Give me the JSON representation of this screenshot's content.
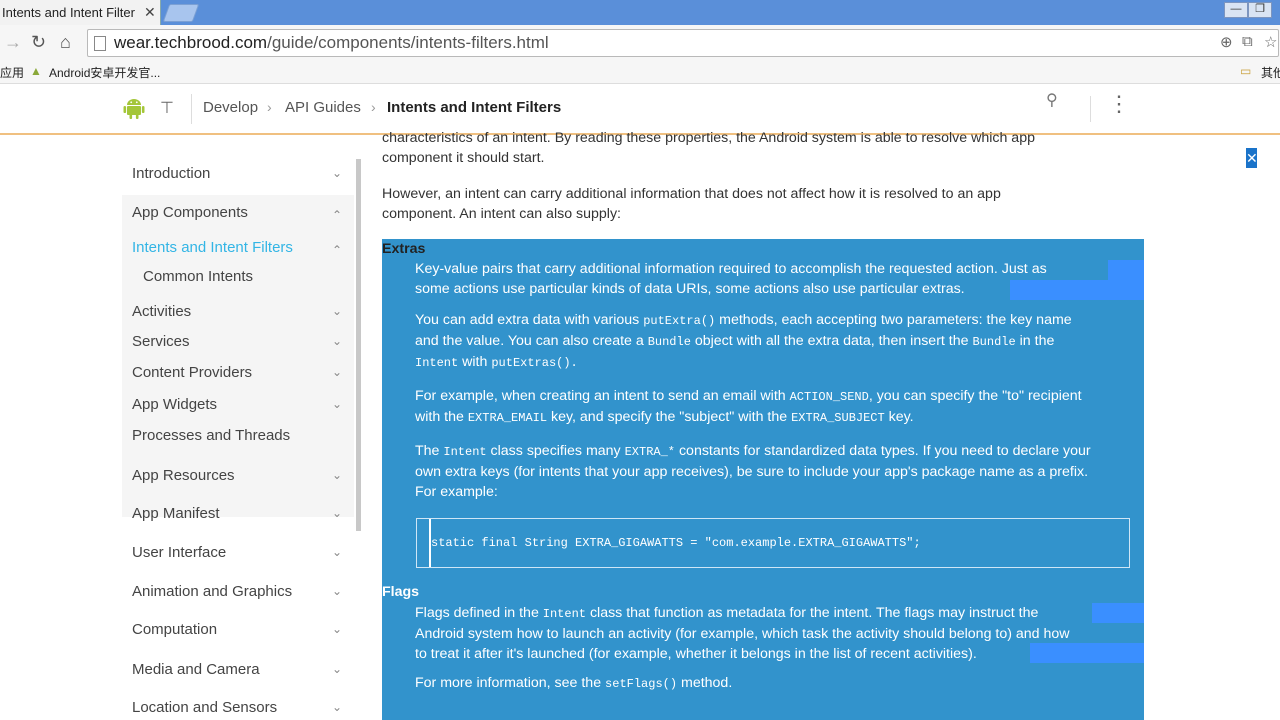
{
  "browser": {
    "tab_title": "Intents and Intent Filter",
    "tab_close": "✕",
    "window_buttons": {
      "minimize": "—",
      "restore": "❐",
      "close": "✕"
    },
    "url_host": "wear.techbrood.com",
    "url_path": "/guide/components/intents-filters.html",
    "bookmarks": {
      "apps": "应用",
      "android": "Android安卓开发官...",
      "other": "其他"
    }
  },
  "header": {
    "crumbs": [
      "Develop",
      "API Guides",
      "Intents and Intent Filters"
    ],
    "chevron": "›"
  },
  "sidebar": {
    "items": [
      {
        "label": "Introduction",
        "arrow": "⌄"
      },
      {
        "label": "App Components",
        "arrow": "⌃"
      },
      {
        "label": "Intents and Intent Filters",
        "arrow": "⌃"
      },
      {
        "label": "Common Intents",
        "arrow": ""
      },
      {
        "label": "Activities",
        "arrow": "⌄"
      },
      {
        "label": "Services",
        "arrow": "⌄"
      },
      {
        "label": "Content Providers",
        "arrow": "⌄"
      },
      {
        "label": "App Widgets",
        "arrow": "⌄"
      },
      {
        "label": "Processes and Threads",
        "arrow": ""
      },
      {
        "label": "App Resources",
        "arrow": "⌄"
      },
      {
        "label": "App Manifest",
        "arrow": "⌄"
      },
      {
        "label": "User Interface",
        "arrow": "⌄"
      },
      {
        "label": "Animation and Graphics",
        "arrow": "⌄"
      },
      {
        "label": "Computation",
        "arrow": "⌄"
      },
      {
        "label": "Media and Camera",
        "arrow": "⌄"
      },
      {
        "label": "Location and Sensors",
        "arrow": "⌄"
      }
    ]
  },
  "content": {
    "intro_line1": "characteristics of an intent. By reading these properties, the Android system is able to resolve which app",
    "intro_line2": "component it should start.",
    "however_line1": "However, an intent can carry additional information that does not affect how it is resolved to an app",
    "however_line2": "component. An intent can also supply:",
    "extras_term": "Extras",
    "extras_p1_l1": "Key-value pairs that carry additional information required to accomplish the requested action. Just as",
    "extras_p1_l2": "some actions use particular kinds of data URIs, some actions also use particular extras.",
    "extras_p2_l1a": "You can add extra data with various ",
    "extras_p2_l1b": "putExtra()",
    "extras_p2_l1c": " methods, each accepting two parameters: the key name",
    "extras_p2_l2a": "and the value. You can also create a ",
    "extras_p2_l2b": "Bundle",
    "extras_p2_l2c": " object with all the extra data, then insert the ",
    "extras_p2_l2d": "Bundle",
    "extras_p2_l2e": " in the",
    "extras_p2_l3a": "Intent",
    "extras_p2_l3b": " with ",
    "extras_p2_l3c": "putExtras().",
    "extras_p3_l1a": "For example, when creating an intent to send an email with ",
    "extras_p3_l1b": "ACTION_SEND",
    "extras_p3_l1c": ", you can specify the \"to\" recipient",
    "extras_p3_l2a": "with the ",
    "extras_p3_l2b": "EXTRA_EMAIL",
    "extras_p3_l2c": " key, and specify the \"subject\" with the ",
    "extras_p3_l2d": "EXTRA_SUBJECT",
    "extras_p3_l2e": " key.",
    "extras_p4_l1a": "The ",
    "extras_p4_l1b": "Intent",
    "extras_p4_l1c": " class specifies many ",
    "extras_p4_l1d": "EXTRA_*",
    "extras_p4_l1e": " constants for standardized data types. If you need to declare your",
    "extras_p4_l2": "own extra keys (for intents that your app receives), be sure to include your app's package name as a prefix.",
    "extras_p4_l3": "For example:",
    "code": "static final String EXTRA_GIGAWATTS = \"com.example.EXTRA_GIGAWATTS\";",
    "flags_term": "Flags",
    "flags_l1a": "Flags defined in the ",
    "flags_l1b": "Intent",
    "flags_l1c": " class that function as metadata for the intent. The flags may instruct the",
    "flags_l2": "Android system how to launch an activity (for example, which task the activity should belong to) and how",
    "flags_l3": "to treat it after it's launched (for example, whether it belongs in the list of recent activities).",
    "flags_more_a": "For more information, see the ",
    "flags_more_b": "setFlags()",
    "flags_more_c": " method."
  },
  "colors": {
    "selection": "#3293cc",
    "accent": "#33b5e5",
    "android_green": "#a4c639"
  }
}
